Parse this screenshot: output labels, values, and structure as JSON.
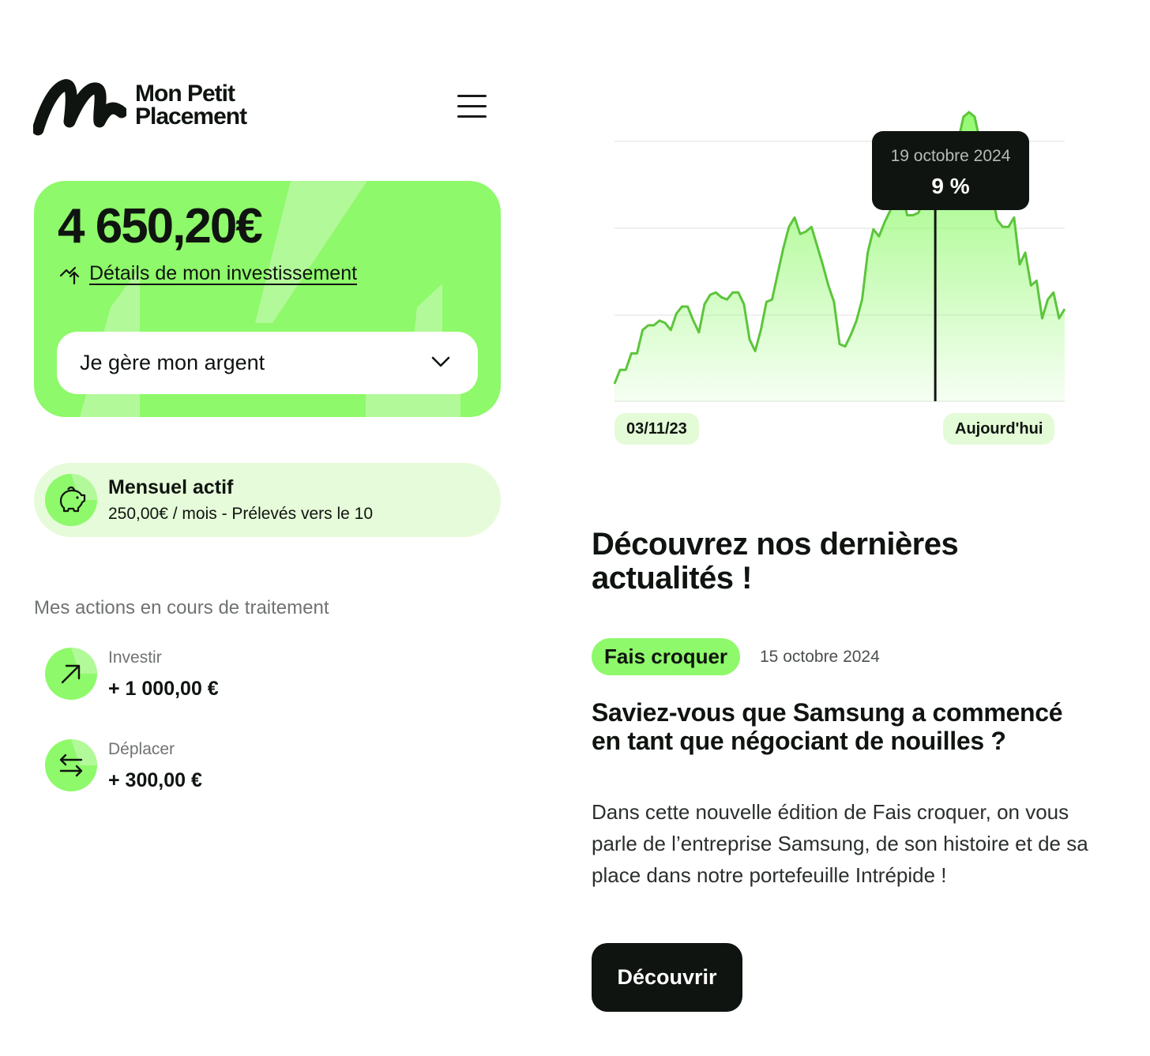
{
  "header": {
    "brand_line1": "Mon Petit",
    "brand_line2": "Placement",
    "menu_icon": "hamburger-icon"
  },
  "balance_card": {
    "amount": "4 650,20€",
    "details_label": "Détails de mon investissement",
    "details_icon": "growth-arrow-icon",
    "select_label": "Je gère mon argent",
    "select_icon": "chevron-down-icon"
  },
  "monthly": {
    "title": "Mensuel actif",
    "subtitle": "250,00€ / mois - Prélevés vers le 10",
    "icon": "piggy-bank-icon"
  },
  "actions": {
    "title": "Mes actions en cours de traitement",
    "items": [
      {
        "label": "Investir",
        "amount": "+ 1 000,00 €",
        "icon": "arrow-up-right-icon"
      },
      {
        "label": "Déplacer",
        "amount": "+ 300,00 €",
        "icon": "swap-arrows-icon"
      }
    ]
  },
  "chart_data": {
    "type": "area",
    "title": "",
    "xlabel": "",
    "ylabel": "",
    "x_start_label": "03/11/23",
    "x_end_label": "Aujourd'hui",
    "grid": true,
    "color": "#5cc53b",
    "values": [
      0.0,
      0.6,
      0.6,
      1.3,
      1.3,
      2.3,
      2.5,
      2.5,
      2.7,
      2.6,
      2.3,
      3.0,
      3.3,
      3.3,
      2.7,
      2.2,
      3.4,
      3.8,
      3.9,
      3.7,
      3.6,
      3.9,
      3.9,
      3.4,
      1.9,
      1.4,
      2.3,
      3.5,
      3.6,
      4.7,
      5.8,
      6.7,
      7.1,
      6.4,
      6.5,
      6.7,
      5.9,
      5.1,
      4.2,
      3.5,
      1.7,
      1.6,
      2.1,
      2.7,
      3.6,
      5.6,
      6.6,
      6.3,
      6.9,
      7.4,
      8.1,
      8.4,
      7.2,
      7.2,
      7.3,
      7.9,
      8.7,
      9.1,
      9.0,
      9.3,
      9.3,
      10.3,
      11.4,
      11.6,
      11.4,
      10.3,
      9.1,
      8.2,
      7.0,
      6.7,
      6.7,
      7.1,
      5.1,
      5.6,
      4.2,
      4.4,
      2.8,
      3.6,
      3.9,
      2.8,
      3.2
    ],
    "highlight": {
      "index": 57,
      "date": "19 octobre 2024",
      "value_label": "9 %"
    }
  },
  "news": {
    "section_title": "Découvrez nos dernières actualités !",
    "tag": "Fais croquer",
    "date": "15 octobre 2024",
    "article_title": "Saviez-vous que Samsung a commencé en tant que négociant de nouilles ?",
    "article_body": "Dans cette nouvelle édition de Fais croquer, on vous parle de l’entreprise Samsung, de son histoire et de sa place dans notre portefeuille Intrépide !",
    "cta_label": "Découvrir"
  },
  "colors": {
    "accent": "#8ef96a",
    "accent_soft": "#e6fbd9",
    "dark": "#0f1410",
    "line": "#5cc53b"
  }
}
